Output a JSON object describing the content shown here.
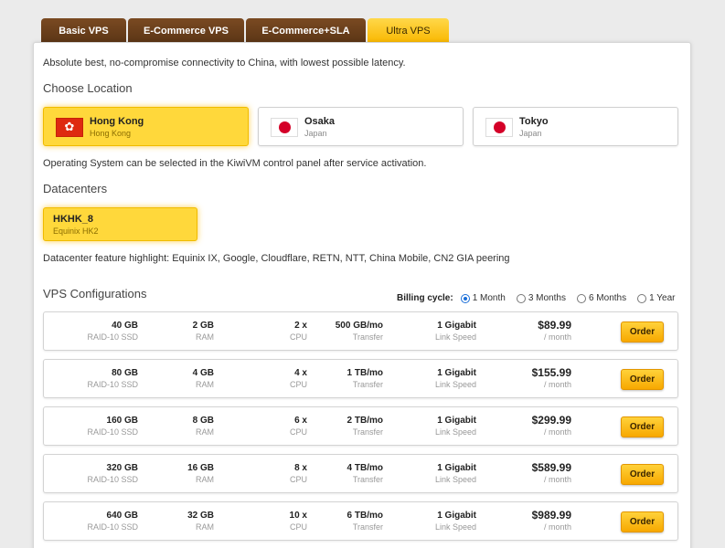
{
  "tabs": [
    {
      "label": "Basic VPS",
      "active": false
    },
    {
      "label": "E-Commerce VPS",
      "active": false
    },
    {
      "label": "E-Commerce+SLA",
      "active": false
    },
    {
      "label": "Ultra VPS",
      "active": true
    }
  ],
  "intro": "Absolute best, no-compromise connectivity to China, with lowest possible latency.",
  "location_heading": "Choose Location",
  "locations": [
    {
      "name": "Hong Kong",
      "sub": "Hong Kong",
      "flag": "hk-flag-icon",
      "selected": true
    },
    {
      "name": "Osaka",
      "sub": "Japan",
      "flag": "jp-flag-icon",
      "selected": false
    },
    {
      "name": "Tokyo",
      "sub": "Japan",
      "flag": "jp-flag-icon",
      "selected": false
    }
  ],
  "os_note": "Operating System can be selected in the KiwiVM control panel after service activation.",
  "datacenter_heading": "Datacenters",
  "datacenter": {
    "name": "HKHK_8",
    "sub": "Equinix HK2",
    "selected": true
  },
  "feature_note": "Datacenter feature highlight: Equinix IX, Google, Cloudflare, RETN, NTT, China Mobile, CN2 GIA peering",
  "config_heading": "VPS Configurations",
  "billing": {
    "label": "Billing cycle:",
    "options": [
      {
        "label": "1 Month",
        "selected": true
      },
      {
        "label": "3 Months",
        "selected": false
      },
      {
        "label": "6 Months",
        "selected": false
      },
      {
        "label": "1 Year",
        "selected": false
      }
    ]
  },
  "labels": {
    "disk": "RAID-10 SSD",
    "ram": "RAM",
    "cpu": "CPU",
    "transfer": "Transfer",
    "link": "Link Speed",
    "period": "/ month",
    "order": "Order"
  },
  "plans": [
    {
      "disk": "40 GB",
      "ram": "2 GB",
      "cpu": "2 x",
      "transfer": "500 GB/mo",
      "link": "1 Gigabit",
      "price": "$89.99"
    },
    {
      "disk": "80 GB",
      "ram": "4 GB",
      "cpu": "4 x",
      "transfer": "1 TB/mo",
      "link": "1 Gigabit",
      "price": "$155.99"
    },
    {
      "disk": "160 GB",
      "ram": "8 GB",
      "cpu": "6 x",
      "transfer": "2 TB/mo",
      "link": "1 Gigabit",
      "price": "$299.99"
    },
    {
      "disk": "320 GB",
      "ram": "16 GB",
      "cpu": "8 x",
      "transfer": "4 TB/mo",
      "link": "1 Gigabit",
      "price": "$589.99"
    },
    {
      "disk": "640 GB",
      "ram": "32 GB",
      "cpu": "10 x",
      "transfer": "6 TB/mo",
      "link": "1 Gigabit",
      "price": "$989.99"
    }
  ],
  "colors": {
    "tab_brown": "#5b3515",
    "accent_yellow": "#ffd83b",
    "radio_blue": "#1a6ed8"
  }
}
